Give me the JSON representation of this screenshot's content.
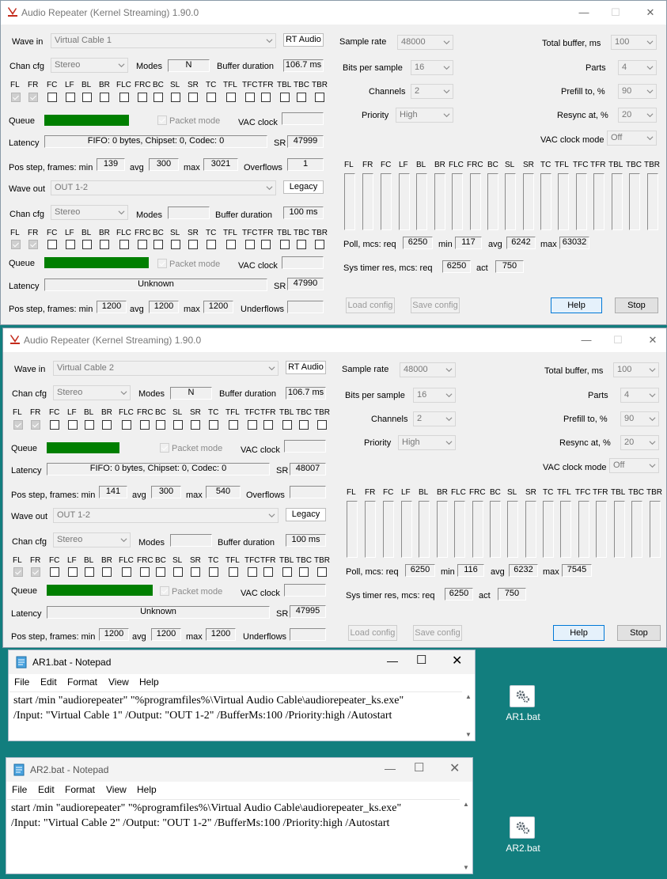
{
  "ar": [
    {
      "title": "Audio Repeater (Kernel Streaming) 1.90.0",
      "wave_in_label": "Wave in",
      "wave_in": "Virtual Cable 1",
      "rt_audio": "RT Audio",
      "chan_cfg_label": "Chan cfg",
      "chan_cfg_in": "Stereo",
      "modes_label": "Modes",
      "modes_in": "N",
      "buffer_duration_label": "Buffer duration",
      "buffer_in": "106.7 ms",
      "queue_label": "Queue",
      "packet_mode": "Packet mode",
      "vac_clock_label": "VAC clock",
      "queue_in_level": 0.74,
      "queue_out_level": 0.86,
      "latency_label": "Latency",
      "latency_in": "FIFO: 0 bytes, Chipset: 0, Codec: 0",
      "sr_label": "SR",
      "sr_in": "47999",
      "pos_label": "Pos step, frames:  min",
      "avg_label": "avg",
      "max_label": "max",
      "pos_in_min": "139",
      "pos_in_avg": "300",
      "pos_in_max": "3021",
      "overflows_label": "Overflows",
      "overflows_in": "1",
      "wave_out_label": "Wave out",
      "wave_out": "OUT 1-2",
      "legacy": "Legacy",
      "chan_cfg_out": "Stereo",
      "modes_out": "",
      "buffer_out": "100 ms",
      "latency_out": "Unknown",
      "sr_out": "47990",
      "pos_out_min": "1200",
      "pos_out_avg": "1200",
      "pos_out_max": "1200",
      "underflows_label": "Underflows",
      "underflows_out": "",
      "sample_rate_label": "Sample rate",
      "sample_rate": "48000",
      "bits_label": "Bits per sample",
      "bits": "16",
      "channels_label": "Channels",
      "channels": "2",
      "priority_label": "Priority",
      "priority": "High",
      "total_buffer_label": "Total buffer, ms",
      "total_buffer": "100",
      "parts_label": "Parts",
      "parts": "4",
      "prefill_label": "Prefill to, %",
      "prefill": "90",
      "resync_label": "Resync at, %",
      "resync": "20",
      "vac_clock_mode_label": "VAC clock mode",
      "vac_clock_mode": "Off",
      "poll_label": "Poll, mcs:  req",
      "poll_req": "6250",
      "poll_min_label": "min",
      "poll_min": "117",
      "poll_avg_label": "avg",
      "poll_avg": "6242",
      "poll_max_label": "max",
      "poll_max": "63032",
      "timer_label": "Sys timer res, mcs:  req",
      "timer_req": "6250",
      "act_label": "act",
      "timer_act": "750",
      "load_config": "Load config",
      "save_config": "Save config",
      "help": "Help",
      "stop": "Stop"
    },
    {
      "title": "Audio Repeater (Kernel Streaming) 1.90.0",
      "wave_in_label": "Wave in",
      "wave_in": "Virtual Cable 2",
      "rt_audio": "RT Audio",
      "chan_cfg_label": "Chan cfg",
      "chan_cfg_in": "Stereo",
      "modes_label": "Modes",
      "modes_in": "N",
      "buffer_duration_label": "Buffer duration",
      "buffer_in": "106.7 ms",
      "queue_label": "Queue",
      "packet_mode": "Packet mode",
      "vac_clock_label": "VAC clock",
      "queue_in_level": 0.64,
      "queue_out_level": 0.87,
      "latency_label": "Latency",
      "latency_in": "FIFO: 0 bytes, Chipset: 0, Codec: 0",
      "sr_label": "SR",
      "sr_in": "48007",
      "pos_label": "Pos step, frames:  min",
      "avg_label": "avg",
      "max_label": "max",
      "pos_in_min": "141",
      "pos_in_avg": "300",
      "pos_in_max": "540",
      "overflows_label": "Overflows",
      "overflows_in": "",
      "wave_out_label": "Wave out",
      "wave_out": "OUT 1-2",
      "legacy": "Legacy",
      "chan_cfg_out": "Stereo",
      "modes_out": "",
      "buffer_out": "100 ms",
      "latency_out": "Unknown",
      "sr_out": "47995",
      "pos_out_min": "1200",
      "pos_out_avg": "1200",
      "pos_out_max": "1200",
      "underflows_label": "Underflows",
      "underflows_out": "",
      "sample_rate_label": "Sample rate",
      "sample_rate": "48000",
      "bits_label": "Bits per sample",
      "bits": "16",
      "channels_label": "Channels",
      "channels": "2",
      "priority_label": "Priority",
      "priority": "High",
      "total_buffer_label": "Total buffer, ms",
      "total_buffer": "100",
      "parts_label": "Parts",
      "parts": "4",
      "prefill_label": "Prefill to, %",
      "prefill": "90",
      "resync_label": "Resync at, %",
      "resync": "20",
      "vac_clock_mode_label": "VAC clock mode",
      "vac_clock_mode": "Off",
      "poll_label": "Poll, mcs:  req",
      "poll_req": "6250",
      "poll_min_label": "min",
      "poll_min": "116",
      "poll_avg_label": "avg",
      "poll_avg": "6232",
      "poll_max_label": "max",
      "poll_max": "7545",
      "timer_label": "Sys timer res, mcs:  req",
      "timer_req": "6250",
      "act_label": "act",
      "timer_act": "750",
      "load_config": "Load config",
      "save_config": "Save config",
      "help": "Help",
      "stop": "Stop"
    }
  ],
  "channels": [
    "FL",
    "FR",
    "FC",
    "LF",
    "BL",
    "BR",
    "FLC",
    "FRC",
    "BC",
    "SL",
    "SR",
    "TC",
    "TFL",
    "TFC",
    "TFR",
    "TBL",
    "TBC",
    "TBR"
  ],
  "meter_channels": [
    "FL",
    "FR",
    "FC",
    "LF",
    "BL",
    "BR",
    "FLC",
    "FRC",
    "BC",
    "SL",
    "SR",
    "TC",
    "TFL",
    "TFC",
    "TFR",
    "TBL",
    "TBC",
    "TBR"
  ],
  "notepads": [
    {
      "title": "AR1.bat - Notepad",
      "menu": [
        "File",
        "Edit",
        "Format",
        "View",
        "Help"
      ],
      "line1": "start /min \"audiorepeater\" \"%programfiles%\\Virtual Audio Cable\\audiorepeater_ks.exe\"",
      "line2": "/Input: \"Virtual Cable 1\" /Output: \"OUT 1-2\" /BufferMs:100 /Priority:high /Autostart"
    },
    {
      "title": "AR2.bat - Notepad",
      "menu": [
        "File",
        "Edit",
        "Format",
        "View",
        "Help"
      ],
      "line1": "start /min \"audiorepeater\" \"%programfiles%\\Virtual Audio Cable\\audiorepeater_ks.exe\"",
      "line2": "/Input: \"Virtual Cable 2\" /Output: \"OUT 1-2\" /BufferMs:100 /Priority:high /Autostart"
    }
  ],
  "desktop_icons": [
    {
      "label": "AR1.bat",
      "icon": "bat-file-icon"
    },
    {
      "label": "AR2.bat",
      "icon": "bat-file-icon"
    }
  ],
  "colors": {
    "desktop": "#127e7e",
    "queue_bar": "#007f00",
    "app_icon": "#c42b1c"
  }
}
